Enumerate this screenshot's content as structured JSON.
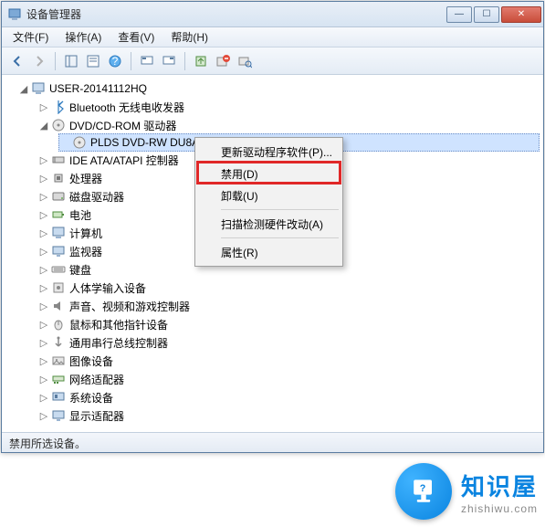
{
  "window": {
    "title": "设备管理器",
    "buttons": {
      "min": "—",
      "max": "☐",
      "close": "✕"
    }
  },
  "menu": [
    {
      "label": "文件(F)"
    },
    {
      "label": "操作(A)"
    },
    {
      "label": "查看(V)"
    },
    {
      "label": "帮助(H)"
    }
  ],
  "tree": {
    "root": "USER-20141112HQ",
    "items": [
      {
        "label": "Bluetooth 无线电收发器",
        "icon": "bluetooth"
      },
      {
        "label": "DVD/CD-ROM 驱动器",
        "icon": "disc",
        "expanded": true,
        "children": [
          {
            "label": "PLDS DVD-RW DU8A5SH",
            "icon": "disc",
            "selected": true
          }
        ]
      },
      {
        "label": "IDE ATA/ATAPI 控制器",
        "icon": "ide"
      },
      {
        "label": "处理器",
        "icon": "cpu"
      },
      {
        "label": "磁盘驱动器",
        "icon": "hdd"
      },
      {
        "label": "电池",
        "icon": "battery"
      },
      {
        "label": "计算机",
        "icon": "computer"
      },
      {
        "label": "监视器",
        "icon": "monitor"
      },
      {
        "label": "键盘",
        "icon": "keyboard"
      },
      {
        "label": "人体学输入设备",
        "icon": "hid"
      },
      {
        "label": "声音、视频和游戏控制器",
        "icon": "sound"
      },
      {
        "label": "鼠标和其他指针设备",
        "icon": "mouse"
      },
      {
        "label": "通用串行总线控制器",
        "icon": "usb"
      },
      {
        "label": "图像设备",
        "icon": "image"
      },
      {
        "label": "网络适配器",
        "icon": "network"
      },
      {
        "label": "系统设备",
        "icon": "system"
      },
      {
        "label": "显示适配器",
        "icon": "display"
      }
    ]
  },
  "context_menu": {
    "items": [
      {
        "label": "更新驱动程序软件(P)..."
      },
      {
        "label": "禁用(D)",
        "highlighted": true
      },
      {
        "label": "卸载(U)"
      },
      {
        "sep": true
      },
      {
        "label": "扫描检测硬件改动(A)"
      },
      {
        "sep": true
      },
      {
        "label": "属性(R)"
      }
    ]
  },
  "statusbar": "禁用所选设备。",
  "watermark": {
    "name": "知识屋",
    "domain": "zhishiwu.com"
  }
}
